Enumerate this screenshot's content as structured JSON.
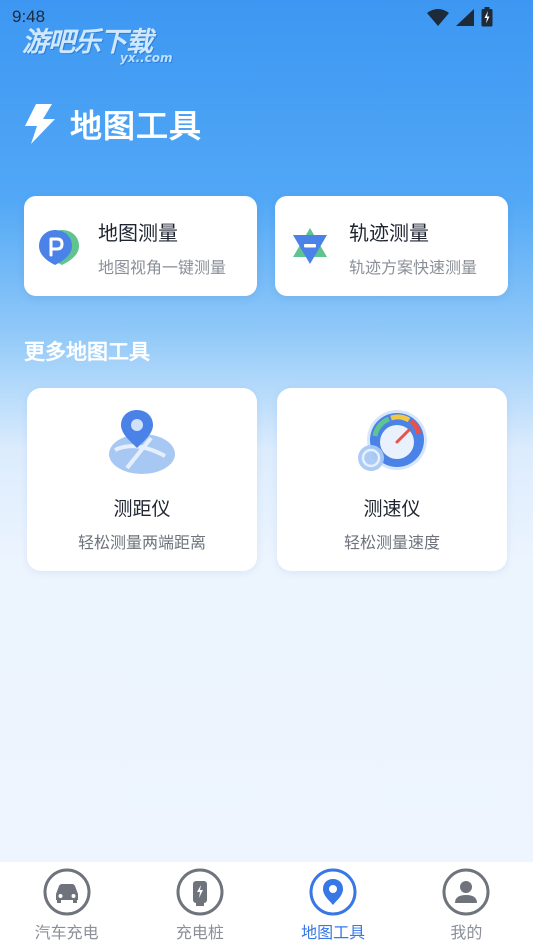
{
  "status_bar": {
    "time": "9:48"
  },
  "watermark": {
    "text": "游吧乐下载",
    "sub": "yx..com"
  },
  "header": {
    "title": "地图工具"
  },
  "top_cards": [
    {
      "title": "地图测量",
      "subtitle": "地图视角一键测量",
      "icon": "map-pin-icon"
    },
    {
      "title": "轨迹测量",
      "subtitle": "轨迹方案快速测量",
      "icon": "track-icon"
    }
  ],
  "section": {
    "title": "更多地图工具"
  },
  "tool_cards": [
    {
      "title": "测距仪",
      "subtitle": "轻松测量两端距离",
      "icon": "distance-map-icon"
    },
    {
      "title": "测速仪",
      "subtitle": "轻松测量速度",
      "icon": "speedometer-icon"
    }
  ],
  "bottom_nav": {
    "items": [
      {
        "label": "汽车充电",
        "icon": "car-icon"
      },
      {
        "label": "充电桩",
        "icon": "charging-pile-icon"
      },
      {
        "label": "地图工具",
        "icon": "location-pin-icon",
        "active": true
      },
      {
        "label": "我的",
        "icon": "user-icon"
      }
    ]
  },
  "colors": {
    "accent": "#3777e6",
    "header_blue": "#3d97f2",
    "inactive": "#8a8f98"
  }
}
